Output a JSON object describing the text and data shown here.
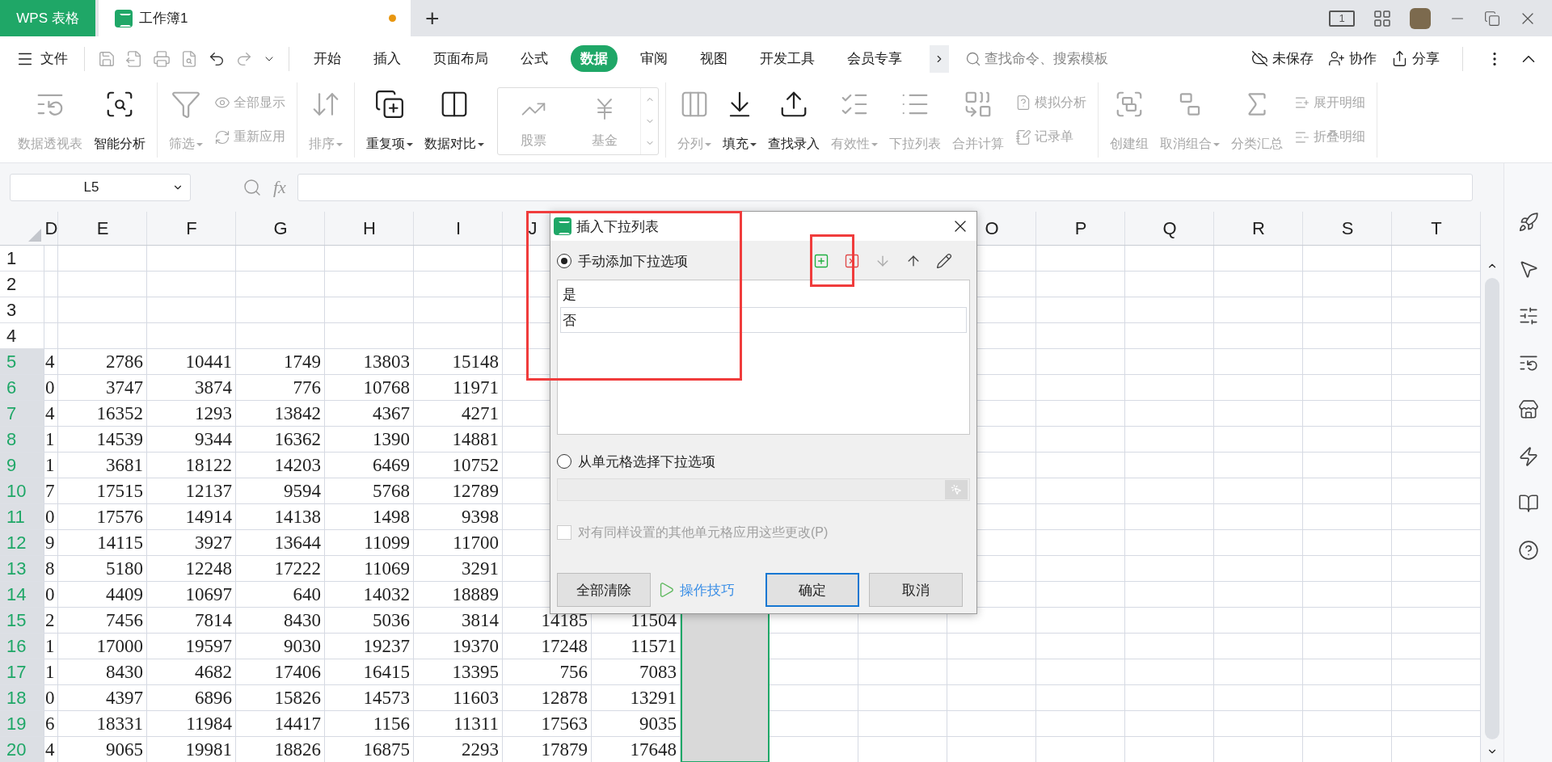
{
  "title_bar": {
    "app_tab": "WPS 表格",
    "doc_tab": {
      "title": "工作簿1",
      "unsaved": true
    },
    "new_tab": "+",
    "device_badge": "1"
  },
  "menu": {
    "file": "文件",
    "quick_access": [
      {
        "kind": "save",
        "disabled": true
      },
      {
        "kind": "export",
        "disabled": true
      },
      {
        "kind": "print",
        "disabled": true
      },
      {
        "kind": "preview",
        "disabled": true
      },
      {
        "kind": "undo",
        "disabled": false
      },
      {
        "kind": "redo",
        "disabled": true
      },
      {
        "kind": "more",
        "disabled": false
      }
    ],
    "tabs": [
      {
        "label": "开始",
        "selected": false
      },
      {
        "label": "插入",
        "selected": false
      },
      {
        "label": "页面布局",
        "selected": false
      },
      {
        "label": "公式",
        "selected": false
      },
      {
        "label": "数据",
        "selected": true
      },
      {
        "label": "审阅",
        "selected": false
      },
      {
        "label": "视图",
        "selected": false
      },
      {
        "label": "开发工具",
        "selected": false
      },
      {
        "label": "会员专享",
        "selected": false
      }
    ],
    "search": {
      "placeholder": "查找命令、搜索模板"
    },
    "actions": [
      {
        "kind": "cloud",
        "label": "未保存"
      },
      {
        "kind": "collab",
        "label": "协作"
      },
      {
        "kind": "share",
        "label": "分享"
      }
    ]
  },
  "ribbon": [
    {
      "items": [
        {
          "kind": "large",
          "label": "数据透视表",
          "disabled": true,
          "dropdown": false
        },
        {
          "kind": "large",
          "label": "智能分析",
          "disabled": false,
          "dropdown": false
        }
      ]
    },
    {
      "items": [
        {
          "kind": "large",
          "label": "筛选",
          "disabled": true,
          "dropdown": true
        },
        {
          "kind": "stack",
          "items": [
            {
              "label": "全部显示",
              "disabled": true
            },
            {
              "label": "重新应用",
              "disabled": true
            }
          ]
        }
      ]
    },
    {
      "items": [
        {
          "kind": "large",
          "label": "排序",
          "disabled": true,
          "dropdown": true
        }
      ]
    },
    {
      "items": [
        {
          "kind": "large",
          "label": "重复项",
          "disabled": false,
          "dropdown": true
        },
        {
          "kind": "large",
          "label": "数据对比",
          "disabled": false,
          "dropdown": true
        },
        {
          "kind": "gallery",
          "items": [
            {
              "label": "股票",
              "disabled": true
            },
            {
              "label": "基金",
              "disabled": true
            }
          ]
        }
      ]
    },
    {
      "items": [
        {
          "kind": "large",
          "label": "分列",
          "disabled": true,
          "dropdown": true
        },
        {
          "kind": "large",
          "label": "填充",
          "disabled": false,
          "dropdown": true
        },
        {
          "kind": "large",
          "label": "查找录入",
          "disabled": false,
          "dropdown": false
        },
        {
          "kind": "large",
          "label": "有效性",
          "disabled": true,
          "dropdown": true
        },
        {
          "kind": "large",
          "label": "下拉列表",
          "disabled": true,
          "dropdown": false
        },
        {
          "kind": "large",
          "label": "合并计算",
          "disabled": true,
          "dropdown": false
        },
        {
          "kind": "stack",
          "items": [
            {
              "label": "模拟分析",
              "disabled": true
            },
            {
              "label": "记录单",
              "disabled": true
            }
          ]
        }
      ]
    },
    {
      "items": [
        {
          "kind": "large",
          "label": "创建组",
          "disabled": true,
          "dropdown": false
        },
        {
          "kind": "large",
          "label": "取消组合",
          "disabled": true,
          "dropdown": true
        },
        {
          "kind": "large",
          "label": "分类汇总",
          "disabled": true,
          "dropdown": false
        },
        {
          "kind": "stack",
          "items": [
            {
              "label": "展开明细",
              "disabled": true
            },
            {
              "label": "折叠明细",
              "disabled": true
            }
          ]
        }
      ]
    }
  ],
  "formula_bar": {
    "name_box": "L5",
    "fx": "fx"
  },
  "sheet": {
    "columns": [
      "D",
      "E",
      "F",
      "G",
      "H",
      "I",
      "J",
      null,
      null,
      null,
      null,
      "O",
      "P",
      "Q",
      "R",
      "S",
      "T"
    ],
    "selection": {
      "on": true
    },
    "rows": [
      {
        "header": "1",
        "selected": false,
        "cells": []
      },
      {
        "header": "2",
        "selected": false,
        "cells": []
      },
      {
        "header": "3",
        "selected": false,
        "cells": []
      },
      {
        "header": "4",
        "selected": false,
        "cells": []
      },
      {
        "header": "5",
        "selected": true,
        "cells": [
          "4",
          "2786",
          "10441",
          "1749",
          "13803",
          "15148"
        ]
      },
      {
        "header": "6",
        "selected": true,
        "cells": [
          "0",
          "3747",
          "3874",
          "776",
          "10768",
          "11971"
        ]
      },
      {
        "header": "7",
        "selected": true,
        "cells": [
          "4",
          "16352",
          "1293",
          "13842",
          "4367",
          "4271"
        ]
      },
      {
        "header": "8",
        "selected": true,
        "cells": [
          "1",
          "14539",
          "9344",
          "16362",
          "1390",
          "14881"
        ]
      },
      {
        "header": "9",
        "selected": true,
        "cells": [
          "1",
          "3681",
          "18122",
          "14203",
          "6469",
          "10752"
        ]
      },
      {
        "header": "10",
        "selected": true,
        "cells": [
          "7",
          "17515",
          "12137",
          "9594",
          "5768",
          "12789"
        ]
      },
      {
        "header": "11",
        "selected": true,
        "cells": [
          "0",
          "17576",
          "14914",
          "14138",
          "1498",
          "9398"
        ]
      },
      {
        "header": "12",
        "selected": true,
        "cells": [
          "9",
          "14115",
          "3927",
          "13644",
          "11099",
          "11700"
        ]
      },
      {
        "header": "13",
        "selected": true,
        "cells": [
          "8",
          "5180",
          "12248",
          "17222",
          "11069",
          "3291"
        ]
      },
      {
        "header": "14",
        "selected": true,
        "cells": [
          "0",
          "4409",
          "10697",
          "640",
          "14032",
          "18889"
        ]
      },
      {
        "header": "15",
        "selected": true,
        "cells": [
          "2",
          "7456",
          "7814",
          "8430",
          "5036",
          "3814",
          "14185",
          "11504"
        ]
      },
      {
        "header": "16",
        "selected": true,
        "cells": [
          "1",
          "17000",
          "19597",
          "9030",
          "19237",
          "19370",
          "17248",
          "11571"
        ]
      },
      {
        "header": "17",
        "selected": true,
        "cells": [
          "1",
          "8430",
          "4682",
          "17406",
          "16415",
          "13395",
          "756",
          "7083"
        ]
      },
      {
        "header": "18",
        "selected": true,
        "cells": [
          "0",
          "4397",
          "6896",
          "15826",
          "14573",
          "11603",
          "12878",
          "13291"
        ]
      },
      {
        "header": "19",
        "selected": true,
        "cells": [
          "6",
          "18331",
          "11984",
          "14417",
          "1156",
          "11311",
          "17563",
          "9035"
        ]
      },
      {
        "header": "20",
        "selected": true,
        "cells": [
          "4",
          "9065",
          "19981",
          "18826",
          "16875",
          "2293",
          "17879",
          "17648"
        ]
      }
    ]
  },
  "dialog": {
    "title": "插入下拉列表",
    "sources": [
      {
        "label": "手动添加下拉选项",
        "selected": true
      },
      {
        "label": "从单元格选择下拉选项",
        "selected": false
      }
    ],
    "toolbar": [
      {
        "kind": "add",
        "disabled": false
      },
      {
        "kind": "delete",
        "disabled": false
      },
      {
        "kind": "down",
        "disabled": true
      },
      {
        "kind": "up",
        "disabled": false
      },
      {
        "kind": "edit",
        "disabled": false
      }
    ],
    "items": [
      {
        "text": "是",
        "selected": false
      },
      {
        "text": "否",
        "selected": true
      }
    ],
    "apply_all": {
      "label": "对有同样设置的其他单元格应用这些更改(P)",
      "checked": false,
      "disabled": true
    },
    "clear_button": "全部清除",
    "tips_link": "操作技巧",
    "buttons": [
      {
        "label": "确定",
        "default": true
      },
      {
        "label": "取消",
        "default": false
      }
    ]
  }
}
